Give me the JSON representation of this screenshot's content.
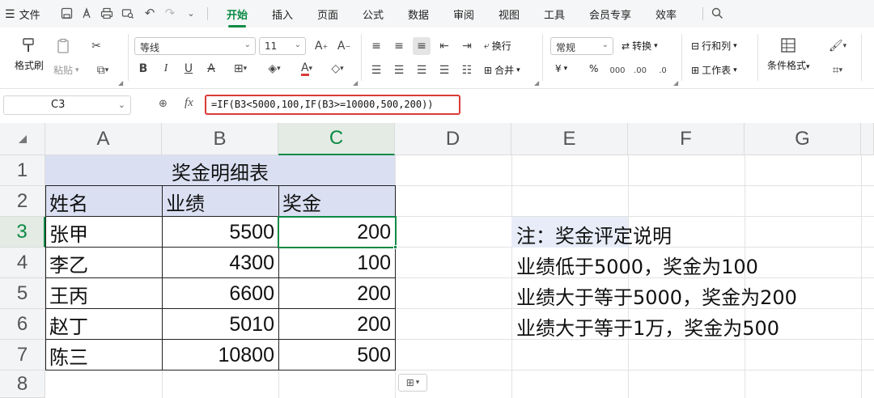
{
  "menubar": {
    "file_label": "文件",
    "tabs": [
      "开始",
      "插入",
      "页面",
      "公式",
      "数据",
      "审阅",
      "视图",
      "工具",
      "会员专享",
      "效率"
    ],
    "active_tab": "开始"
  },
  "ribbon": {
    "format_painter": "格式刷",
    "paste": "粘贴",
    "font_name": "等线",
    "font_size": "11",
    "wrap_text": "换行",
    "merge": "合并",
    "number_format": "常规",
    "convert": "转换",
    "rows_cols": "行和列",
    "worksheet": "工作表",
    "conditional_format": "条件格式",
    "currency_symbol": "¥",
    "percent_symbol": "%"
  },
  "formula_bar": {
    "name_box": "C3",
    "fx": "fx",
    "formula": "=IF(B3<5000,100,IF(B3>=10000,500,200))"
  },
  "sheet": {
    "columns": [
      "A",
      "B",
      "C",
      "D",
      "E",
      "F",
      "G"
    ],
    "selected_column": "C",
    "rows": [
      "1",
      "2",
      "3",
      "4",
      "5",
      "6",
      "7",
      "8"
    ],
    "selected_row": "3",
    "title": "奖金明细表",
    "headers": [
      "姓名",
      "业绩",
      "奖金"
    ],
    "data": [
      {
        "name": "张甲",
        "performance": "5500",
        "bonus": "200"
      },
      {
        "name": "李乙",
        "performance": "4300",
        "bonus": "100"
      },
      {
        "name": "王丙",
        "performance": "6600",
        "bonus": "200"
      },
      {
        "name": "赵丁",
        "performance": "5010",
        "bonus": "200"
      },
      {
        "name": "陈三",
        "performance": "10800",
        "bonus": "500"
      }
    ],
    "notes": [
      "注：奖金评定说明",
      "业绩低于5000，奖金为100",
      "业绩大于等于5000，奖金为200",
      "业绩大于等于1万，奖金为500"
    ]
  },
  "colors": {
    "accent": "#0b8a44",
    "title_fill": "#dae0f2",
    "formula_border": "#d93b36"
  }
}
